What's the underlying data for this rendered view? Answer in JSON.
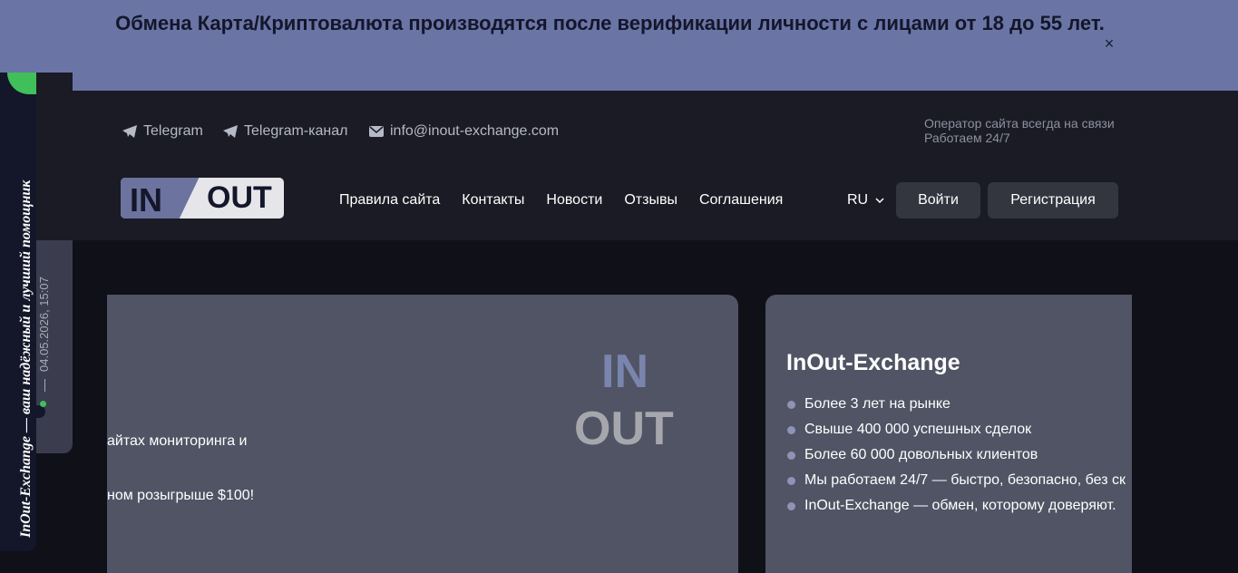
{
  "banner": {
    "text": "Обмена Карта/Криптовалюта производятся после верификации личности с лицами от 18 до 55 лет.",
    "close_label": "×"
  },
  "contacts": {
    "telegram": "Telegram",
    "telegram_channel": "Telegram-канал",
    "email": "info@inout-exchange.com",
    "operator_line1": "Оператор сайта всегда на связи",
    "operator_line2": "Работаем 24/7"
  },
  "logo": {
    "in": "IN",
    "out": "OUT"
  },
  "nav": {
    "items": [
      "Правила сайта",
      "Контакты",
      "Новости",
      "Отзывы",
      "Соглашения"
    ],
    "language": "RU",
    "login": "Войти",
    "register": "Регистрация"
  },
  "side_widget": {
    "tagline": "InOut-Exchange — ваш надёжный и лучший помощник",
    "datetime": "04.05.2026, 15:07"
  },
  "promo": {
    "line1": "айтах мониторинга и",
    "line2": "ном розыгрыше $100!",
    "big_in": "IN",
    "big_out": "OUT"
  },
  "about": {
    "title": "InOut-Exchange",
    "items": [
      "Более 3 лет на рынке",
      "Свыше 400 000 успешных сделок",
      "Более 60 000 довольных клиентов",
      "Мы работаем 24/7 — быстро, безопасно, без ск",
      "InOut-Exchange — обмен, которому доверяют."
    ]
  },
  "colors": {
    "banner_bg": "#6a75a6",
    "header_bg": "#1a1b24",
    "card_bg": "#505464",
    "accent_green": "#3fc05a"
  }
}
